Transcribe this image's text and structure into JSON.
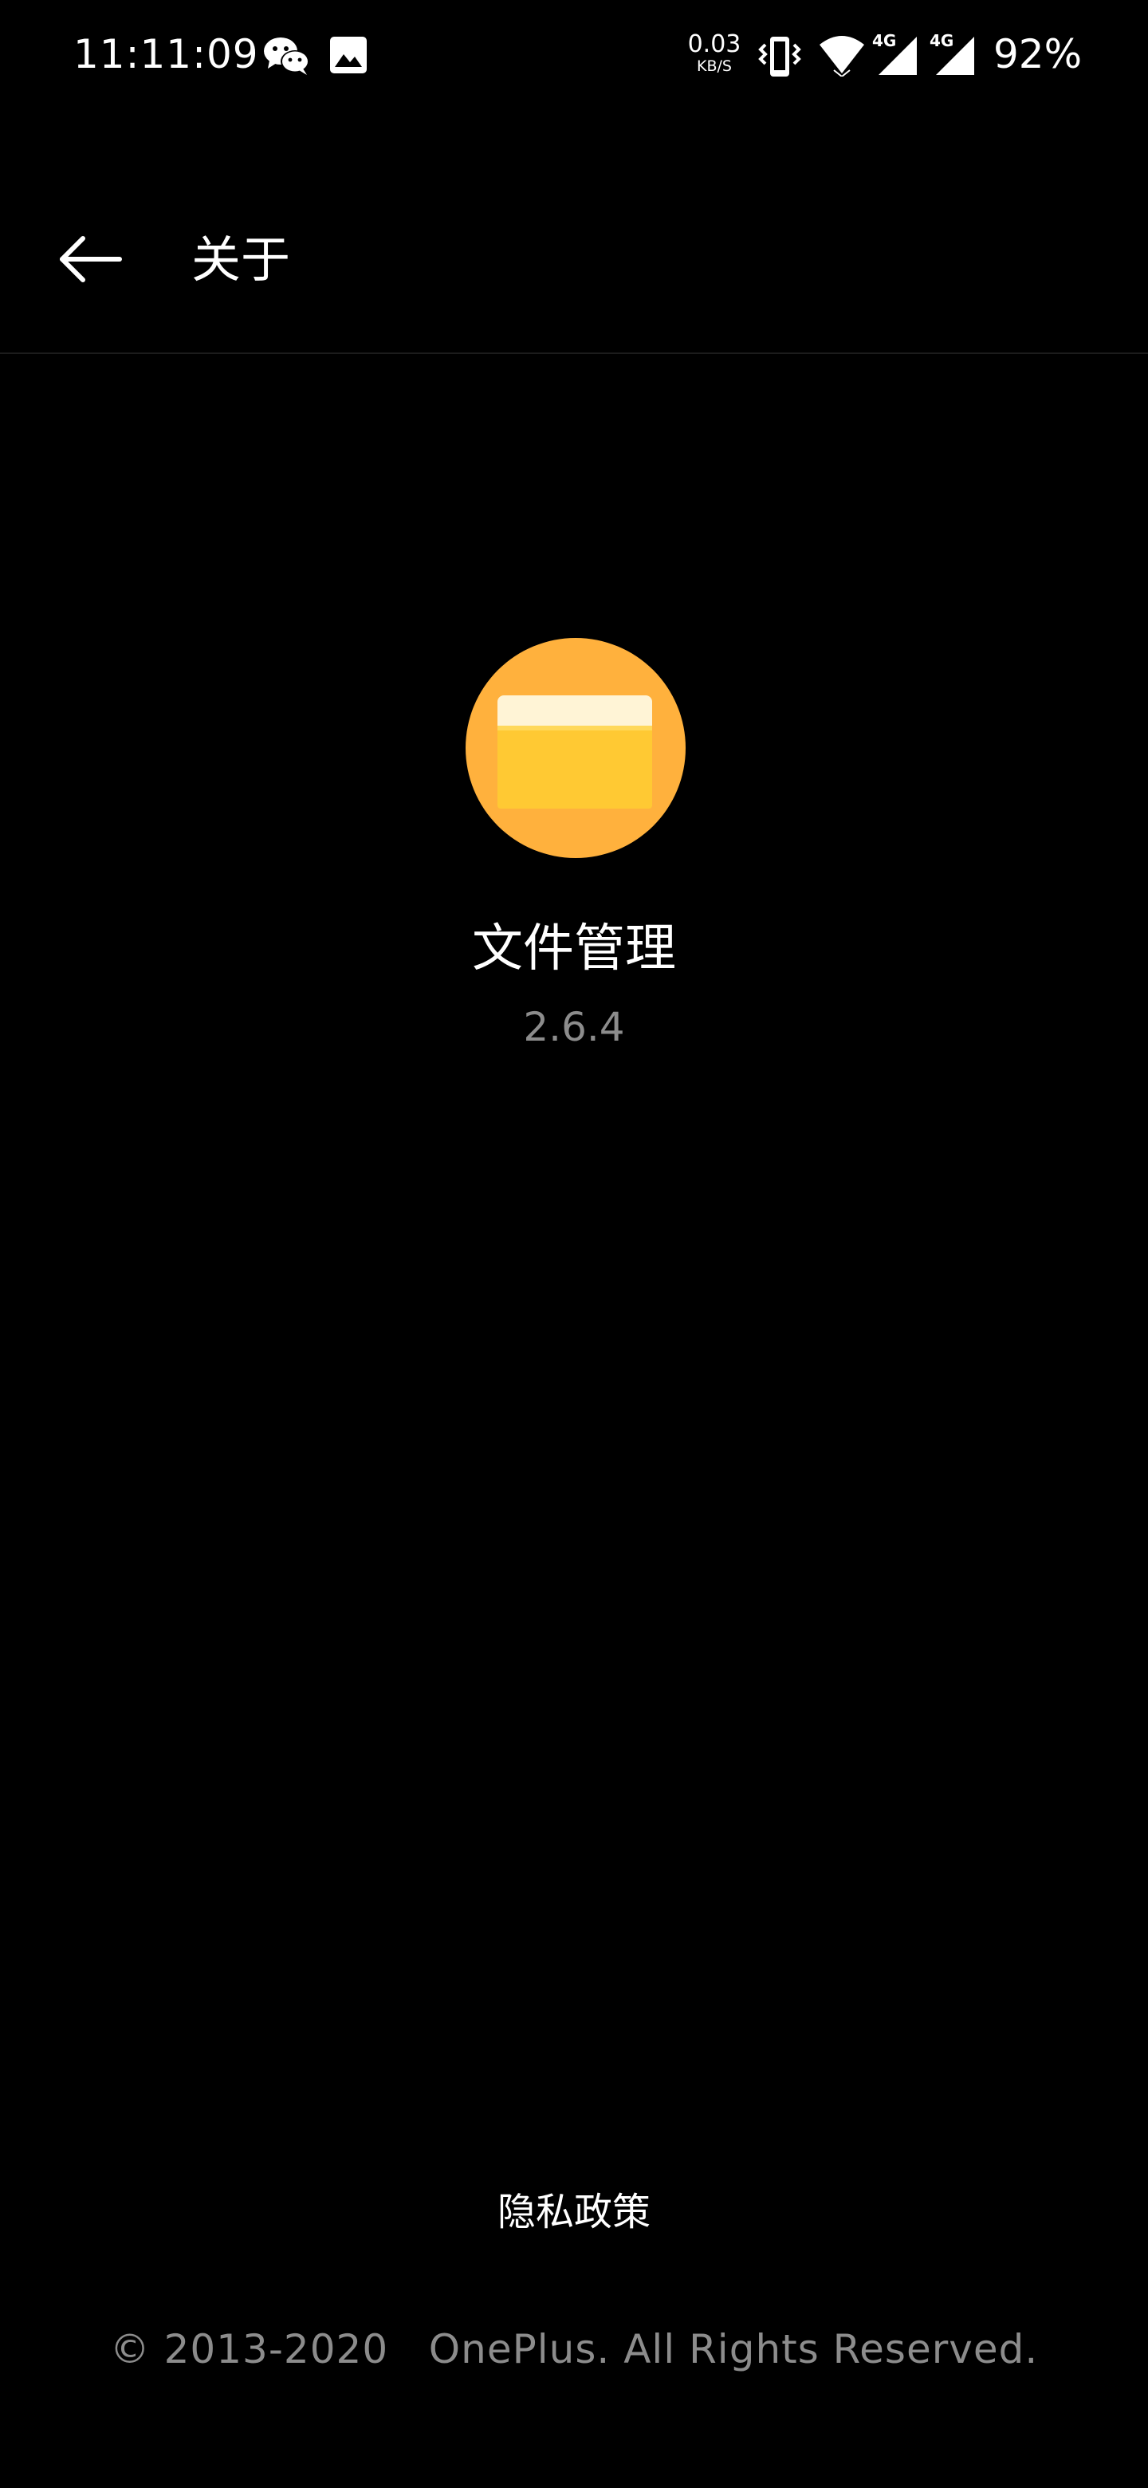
{
  "status_bar": {
    "time": "11:11:09",
    "net_speed_value": "0.03",
    "net_speed_unit": "KB/S",
    "network_label_1": "4G",
    "network_label_2": "4G",
    "battery": "92%",
    "icons": [
      "wechat-icon",
      "gallery-icon",
      "vibrate-icon",
      "wifi-icon",
      "signal-icon",
      "signal-icon"
    ]
  },
  "app_bar": {
    "title": "关于",
    "back_icon": "back-arrow-icon"
  },
  "about": {
    "app_name": "文件管理",
    "version": "2.6.4",
    "icon": "file-manager-folder-icon",
    "icon_colors": {
      "circle": "#FFB13D",
      "folder": "#FFC933",
      "folder_tab": "#FFF4D6"
    }
  },
  "footer": {
    "privacy_policy": "隐私政策",
    "copyright": "© 2013-2020   OnePlus. All Rights Reserved."
  }
}
